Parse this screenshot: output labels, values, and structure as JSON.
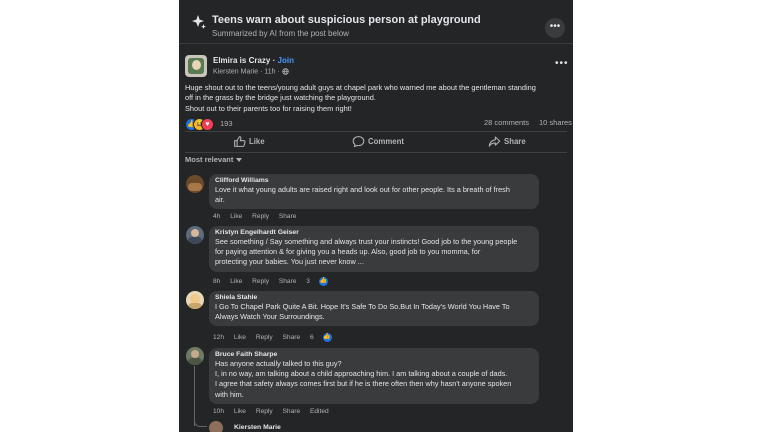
{
  "summary": {
    "title": "Teens warn about suspicious person at playground",
    "subtitle": "Summarized by AI from the post below",
    "more_icon": "ellipsis-icon"
  },
  "post": {
    "group_name": "Elmira is Crazy",
    "separator": "·",
    "join_label": "Join",
    "author": "Kiersten Marie",
    "time": "11h",
    "audience_icon": "globe-icon",
    "body_lines": [
      "Huge shout out to the teens/young adult guys at chapel park who warned me about the gentleman standing",
      "off in the grass by the bridge just watching the playground.",
      "Shout out to their parents too for raising them right!"
    ],
    "reaction_count": "193",
    "comments_label": "28 comments",
    "shares_label": "10 shares",
    "like_label": "Like",
    "comment_label": "Comment",
    "share_label": "Share"
  },
  "sort_label": "Most relevant",
  "comments": [
    {
      "name": "Clifford Williams",
      "lines": [
        "Love it what young adults are raised right and look out for other people. Its a breath of fresh",
        "air."
      ],
      "time": "4h",
      "like": "Like",
      "reply": "Reply",
      "share": "Share"
    },
    {
      "name": "Kristyn Engelhardt Geiser",
      "lines": [
        "See something / Say something and always trust your instincts! Good job to the young people",
        "for paying attention & for giving you a heads up. Also, good job to you momma, for",
        "protecting your babies. You just never know ..."
      ],
      "time": "8h",
      "like": "Like",
      "reply": "Reply",
      "share": "Share",
      "likes": "3"
    },
    {
      "name": "Shiela Stahle",
      "lines": [
        "I Go To Chapel Park Quite A Bit. Hope It's Safe To Do So.But In Today's World You Have To",
        "Always Watch Your Surroundings."
      ],
      "time": "12h",
      "like": "Like",
      "reply": "Reply",
      "share": "Share",
      "likes": "6"
    },
    {
      "name": "Bruce Faith Sharpe",
      "lines": [
        "Has anyone actually talked to this guy?",
        "I, in no way, am talking about a child approaching him. I am talking about a couple of dads.",
        "I agree that safety always comes first but if he is there often then why hasn't anyone spoken",
        "with him."
      ],
      "time": "10h",
      "like": "Like",
      "reply": "Reply",
      "share": "Share",
      "edited": "Edited"
    }
  ],
  "reply_preview_name": "Kiersten Marie",
  "colors": {
    "panel_bg": "#242526",
    "bubble_bg": "#3a3b3c",
    "primary_text": "#e4e6eb",
    "secondary_text": "#b0b3b8",
    "link_blue": "#4599ff"
  }
}
